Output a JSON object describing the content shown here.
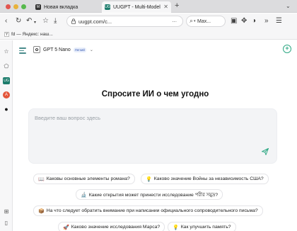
{
  "tabs": [
    {
      "label": "Новая вкладка",
      "favicon": "M"
    },
    {
      "label": "UUGPT - Multi-Model",
      "favicon": "UG"
    }
  ],
  "toolbar": {
    "url": "uugpt.com/c...",
    "url_more": "...",
    "search_label": "Max..."
  },
  "bookmarks": [
    {
      "label": "fd — Яндекс: наш...",
      "icon": "Y"
    }
  ],
  "model": {
    "name": "GPT 5 Nano",
    "badge": "Легкий"
  },
  "main": {
    "heading": "Спросите ИИ о чем угодно",
    "placeholder": "Введите ваш вопрос здесь"
  },
  "suggestions": [
    {
      "emoji": "📖",
      "text": "Каковы основные элементы романа?"
    },
    {
      "emoji": "💡",
      "text": "Каково значение Войны за независимость США?"
    },
    {
      "emoji": "🔬",
      "text": "Какие открытия может принести исследование পরীর সমুদ্র?"
    },
    {
      "emoji": "📦",
      "text": "На что следует обратить внимание при написании официального сопроводительного письма?"
    },
    {
      "emoji": "🚀",
      "text": "Каково значение исследования Марса?"
    },
    {
      "emoji": "💡",
      "text": "Как улучшить память?"
    }
  ],
  "colors": {
    "accent": "#2fa884",
    "hamburger": "#4a8c8c",
    "badge_text": "#3c5fb4"
  }
}
